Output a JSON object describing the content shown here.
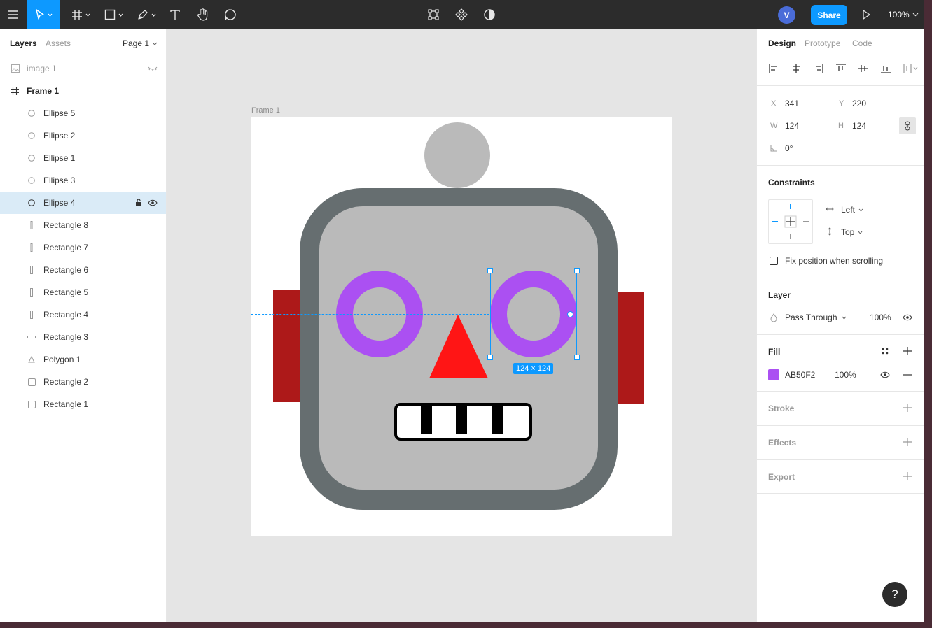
{
  "toolbar": {
    "zoom": "100%",
    "share_label": "Share",
    "avatar_initial": "V",
    "tools": [
      "menu-icon",
      "move-tool-icon",
      "frame-tool-icon",
      "shape-tool-icon",
      "pen-tool-icon",
      "text-tool-icon",
      "hand-tool-icon",
      "comment-tool-icon"
    ],
    "center_tools": [
      "edit-object-icon",
      "component-icon",
      "mask-icon"
    ]
  },
  "left_panel": {
    "tabs": [
      "Layers",
      "Assets"
    ],
    "page": "Page 1",
    "layers": [
      {
        "name": "image 1",
        "icon": "image-icon",
        "hidden": true
      },
      {
        "name": "Frame 1",
        "icon": "frame-icon"
      },
      {
        "name": "Ellipse 5",
        "icon": "ellipse-icon"
      },
      {
        "name": "Ellipse 2",
        "icon": "ellipse-icon"
      },
      {
        "name": "Ellipse 1",
        "icon": "ellipse-icon"
      },
      {
        "name": "Ellipse 3",
        "icon": "ellipse-icon"
      },
      {
        "name": "Ellipse 4",
        "icon": "ellipse-icon",
        "selected": true
      },
      {
        "name": "Rectangle 8",
        "icon": "rectangle-icon"
      },
      {
        "name": "Rectangle 7",
        "icon": "rectangle-icon"
      },
      {
        "name": "Rectangle 6",
        "icon": "rectangle-icon"
      },
      {
        "name": "Rectangle 5",
        "icon": "rectangle-icon"
      },
      {
        "name": "Rectangle 4",
        "icon": "rectangle-icon"
      },
      {
        "name": "Rectangle 3",
        "icon": "rectangle-icon"
      },
      {
        "name": "Polygon 1",
        "icon": "polygon-icon"
      },
      {
        "name": "Rectangle 2",
        "icon": "rectangle-icon"
      },
      {
        "name": "Rectangle 1",
        "icon": "rectangle-icon"
      }
    ]
  },
  "canvas": {
    "frame_label": "Frame 1",
    "selection_size": "124 × 124",
    "colors": {
      "ear": "#ad1919",
      "head_outer": "#666e70",
      "head_inner": "#bababa",
      "antenna": "#bababa",
      "eye": "#ab50f2",
      "nose": "#ff1515",
      "mouth_fill": "#ffffff",
      "mouth_teeth": "#000000"
    }
  },
  "right_panel": {
    "tabs": [
      "Design",
      "Prototype",
      "Code"
    ],
    "x_label": "X",
    "x": "341",
    "y_label": "Y",
    "y": "220",
    "w_label": "W",
    "w": "124",
    "h_label": "H",
    "h": "124",
    "rotation": "0°",
    "constraints_title": "Constraints",
    "constraint_h": "Left",
    "constraint_v": "Top",
    "fix_position": "Fix position when scrolling",
    "layer_title": "Layer",
    "blend_mode": "Pass Through",
    "layer_opacity": "100%",
    "fill_title": "Fill",
    "fill_hex": "AB50F2",
    "fill_opacity": "100%",
    "fill_color": "#ab50f2",
    "stroke_title": "Stroke",
    "effects_title": "Effects",
    "export_title": "Export"
  }
}
